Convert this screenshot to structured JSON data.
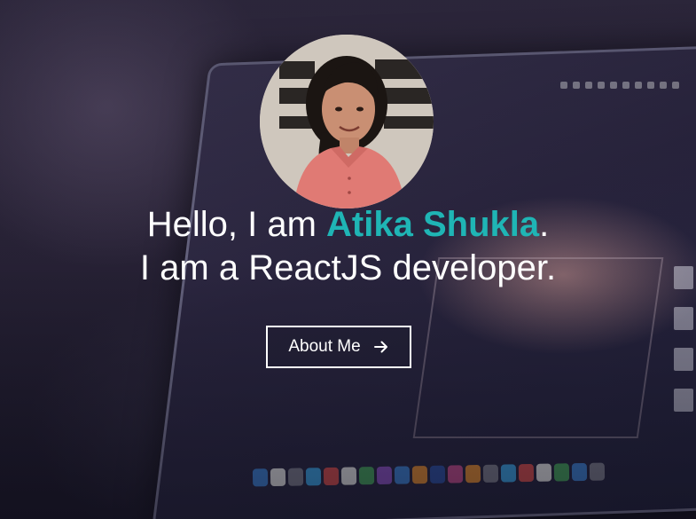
{
  "hero": {
    "greeting": "Hello, I am ",
    "name": "Atika Shukla",
    "period": ".",
    "tagline": "I am a ReactJS developer."
  },
  "cta": {
    "label": "About Me",
    "icon": "arrow-right-icon"
  },
  "avatar": {
    "icon": "profile-photo"
  },
  "colors": {
    "accent": "#1fb5b5",
    "text": "#ffffff",
    "background": "#1d1a2b"
  }
}
